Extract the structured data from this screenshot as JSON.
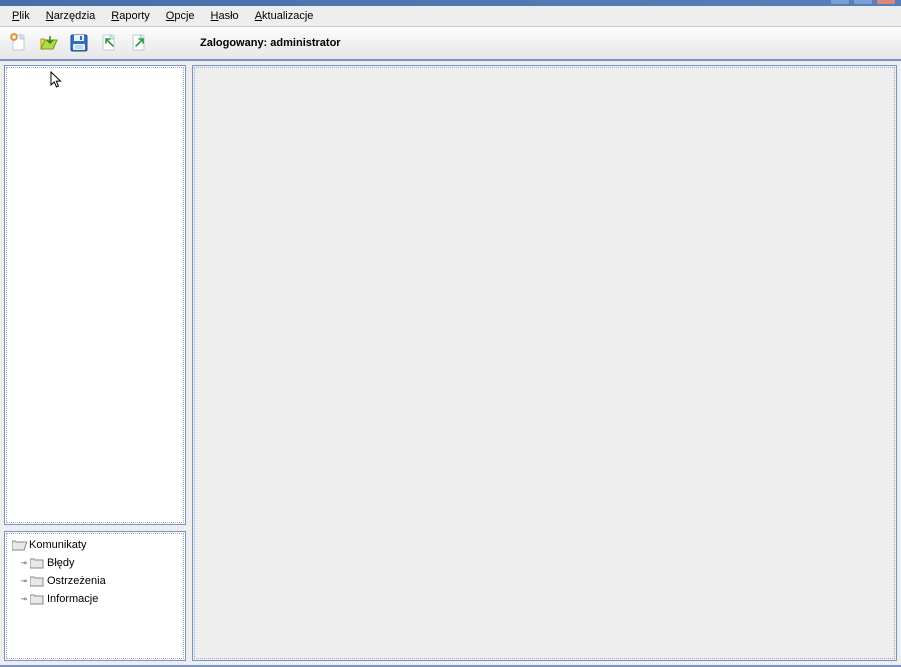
{
  "menu": {
    "plik": "Plik",
    "narzedzia": "Narzędzia",
    "raporty": "Raporty",
    "opcje": "Opcje",
    "haslo": "Hasło",
    "aktualizacje": "Aktualizacje"
  },
  "toolbar": {
    "status_label": "Zalogowany:",
    "status_user": "administrator",
    "icons": {
      "new": "new-file-icon",
      "open": "open-folder-icon",
      "save": "save-floppy-icon",
      "import": "import-doc-icon",
      "export": "export-doc-icon"
    }
  },
  "tree": {
    "root": "Komunikaty",
    "children": [
      {
        "label": "Błędy"
      },
      {
        "label": "Ostrzeżenia"
      },
      {
        "label": "Informacje"
      }
    ]
  }
}
